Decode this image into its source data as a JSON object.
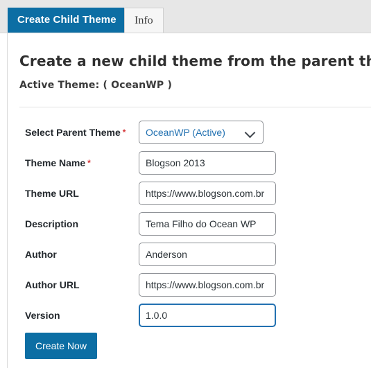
{
  "tabs": [
    {
      "label": "Create Child Theme",
      "active": true
    },
    {
      "label": "Info",
      "active": false
    }
  ],
  "heading": "Create a new child theme from the parent theme",
  "active_theme_line": "Active Theme: ( OceanWP )",
  "required_marker": "*",
  "icons": {
    "chevron": "chevron-down-icon"
  },
  "colors": {
    "accent": "#0c6ea4",
    "focus_border": "#2271b1",
    "required": "#d63638",
    "select_text": "#2271b1",
    "tabstrip_bg": "#e7e7e7"
  },
  "form": {
    "fields": [
      {
        "label": "Select Parent Theme",
        "required": true,
        "type": "select",
        "value": "OceanWP (Active)",
        "options": [
          "OceanWP (Active)"
        ],
        "name": "select-parent-theme"
      },
      {
        "label": "Theme Name",
        "required": true,
        "type": "text",
        "value": "Blogson 2013",
        "placeholder": "",
        "name": "theme-name"
      },
      {
        "label": "Theme URL",
        "required": false,
        "type": "text",
        "value": "https://www.blogson.com.br",
        "placeholder": "",
        "name": "theme-url"
      },
      {
        "label": "Description",
        "required": false,
        "type": "text",
        "value": "Tema Filho do Ocean WP",
        "placeholder": "",
        "name": "description"
      },
      {
        "label": "Author",
        "required": false,
        "type": "text",
        "value": "Anderson",
        "placeholder": "",
        "name": "author"
      },
      {
        "label": "Author URL",
        "required": false,
        "type": "text",
        "value": "https://www.blogson.com.br",
        "placeholder": "",
        "name": "author-url"
      },
      {
        "label": "Version",
        "required": false,
        "type": "text",
        "value": "1.0.0",
        "placeholder": "",
        "focused": true,
        "name": "version"
      }
    ],
    "submit_label": "Create Now"
  }
}
